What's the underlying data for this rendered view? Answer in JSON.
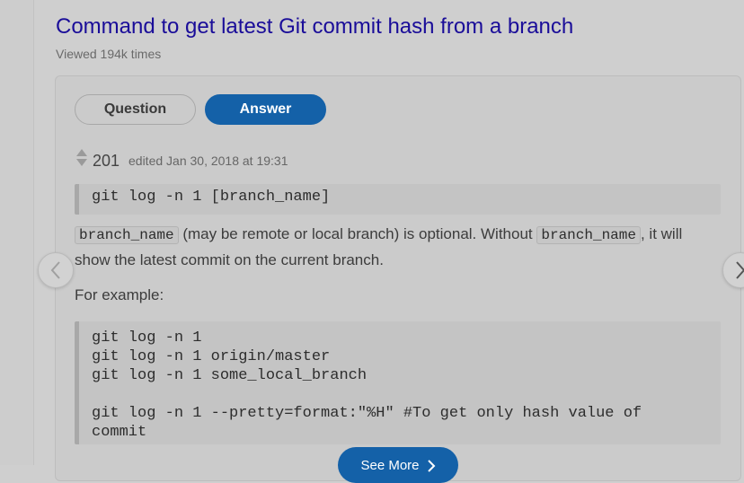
{
  "question": {
    "title": "Command to get latest Git commit hash from a branch",
    "views": "Viewed 194k times"
  },
  "tabs": {
    "question": "Question",
    "answer": "Answer"
  },
  "answer": {
    "score": "201",
    "edited": "edited Jan 30, 2018 at 19:31",
    "code_main": "git log -n 1 [branch_name]",
    "para_code_1": "branch_name",
    "para_text_1": " (may be remote or local branch) is optional. Without ",
    "para_code_2": "branch_name",
    "para_text_2": ", it will show the latest commit on the current branch.",
    "example_label": "For example:",
    "code_example": "git log -n 1\ngit log -n 1 origin/master\ngit log -n 1 some_local_branch\n\ngit log -n 1 --pretty=format:\"%H\" #To get only hash value of\ncommit"
  },
  "see_more": "See More",
  "icons": {
    "prev": "chevron-left-icon",
    "next": "chevron-right-icon",
    "vote": "vote-arrows-icon",
    "see_more": "chevron-right-icon"
  },
  "colors": {
    "title": "#1a0d99",
    "accent": "#1461a8"
  }
}
